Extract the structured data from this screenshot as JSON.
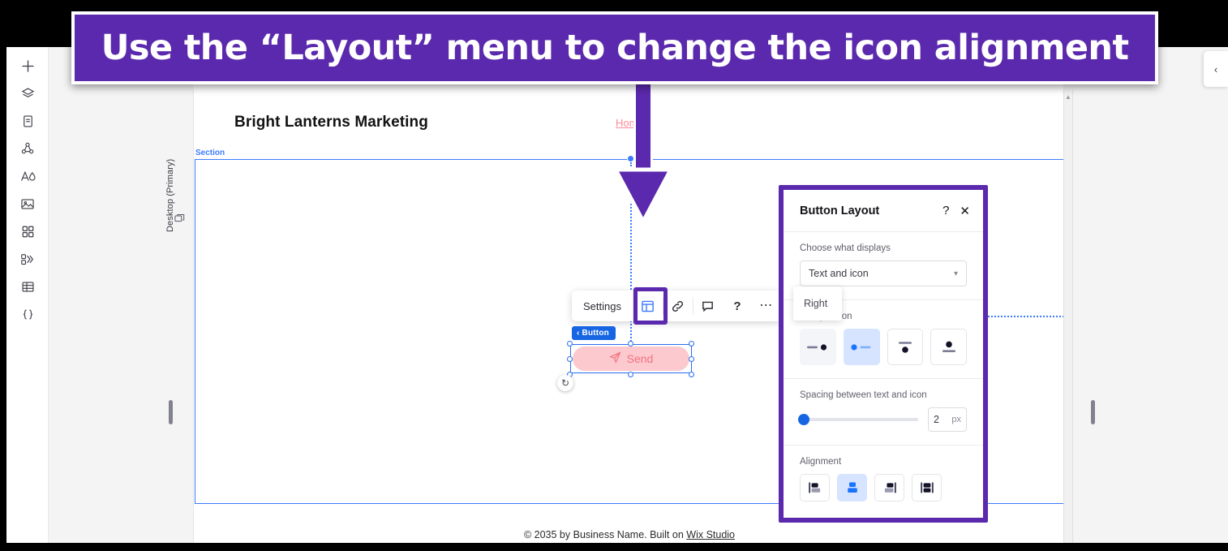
{
  "banner": {
    "text": "Use the “Layout” menu to change the icon alignment",
    "color": "#5b29ad"
  },
  "rail": {
    "items": [
      {
        "name": "add-icon",
        "glyph": "plus"
      },
      {
        "name": "layers-icon",
        "glyph": "layers"
      },
      {
        "name": "pages-icon",
        "glyph": "page"
      },
      {
        "name": "apps-icon",
        "glyph": "nodes"
      },
      {
        "name": "text-icon",
        "glyph": "text"
      },
      {
        "name": "media-icon",
        "glyph": "image"
      },
      {
        "name": "sections-icon",
        "glyph": "grid"
      },
      {
        "name": "interactions-icon",
        "glyph": "motion"
      },
      {
        "name": "cms-icon",
        "glyph": "table"
      },
      {
        "name": "dev-mode-icon",
        "glyph": "braces"
      }
    ]
  },
  "canvas": {
    "viewport_label": "Desktop (Primary)",
    "site_title": "Bright Lanterns Marketing",
    "nav_link": "Hom",
    "section_label": "Section",
    "footer_prefix": "© 2035 by Business Name. Built on ",
    "footer_link": "Wix Studio"
  },
  "element_toolbar": {
    "settings_label": "Settings",
    "buttons": [
      {
        "name": "layout-button",
        "icon": "layout-icon",
        "active": true
      },
      {
        "name": "link-button",
        "icon": "link-icon",
        "active": false
      },
      {
        "name": "comment-button",
        "icon": "comment-icon",
        "active": false
      },
      {
        "name": "help-button",
        "icon": "question-icon",
        "active": false
      },
      {
        "name": "more-button",
        "icon": "ellipsis-icon",
        "active": false
      }
    ]
  },
  "selected_element": {
    "badge_label": "Button",
    "button_text": "Send",
    "button_icon": "send-paper-plane-icon",
    "fill_color": "#fbc9ce",
    "text_color": "#f4737f"
  },
  "panel": {
    "title": "Button Layout",
    "help_glyph": "?",
    "close_glyph": "✕",
    "choose_label": "Choose what displays",
    "select_value": "Text and icon",
    "icon_position_label": "Icon position",
    "icon_position_options": [
      {
        "name": "icon-position-right",
        "selected": false,
        "hover": true
      },
      {
        "name": "icon-position-left",
        "selected": true,
        "hover": false
      },
      {
        "name": "icon-position-bottom",
        "selected": false,
        "hover": false
      },
      {
        "name": "icon-position-top",
        "selected": false,
        "hover": false
      }
    ],
    "tooltip": "Right",
    "spacing_label": "Spacing between text and icon",
    "spacing_value": "2",
    "spacing_unit": "px",
    "spacing_percent": 2,
    "alignment_label": "Alignment",
    "alignment_options": [
      {
        "name": "align-left",
        "selected": false
      },
      {
        "name": "align-center",
        "selected": true
      },
      {
        "name": "align-right",
        "selected": false
      },
      {
        "name": "align-justify",
        "selected": false
      }
    ]
  },
  "right_panel": {
    "collapse_glyph": "‹"
  }
}
